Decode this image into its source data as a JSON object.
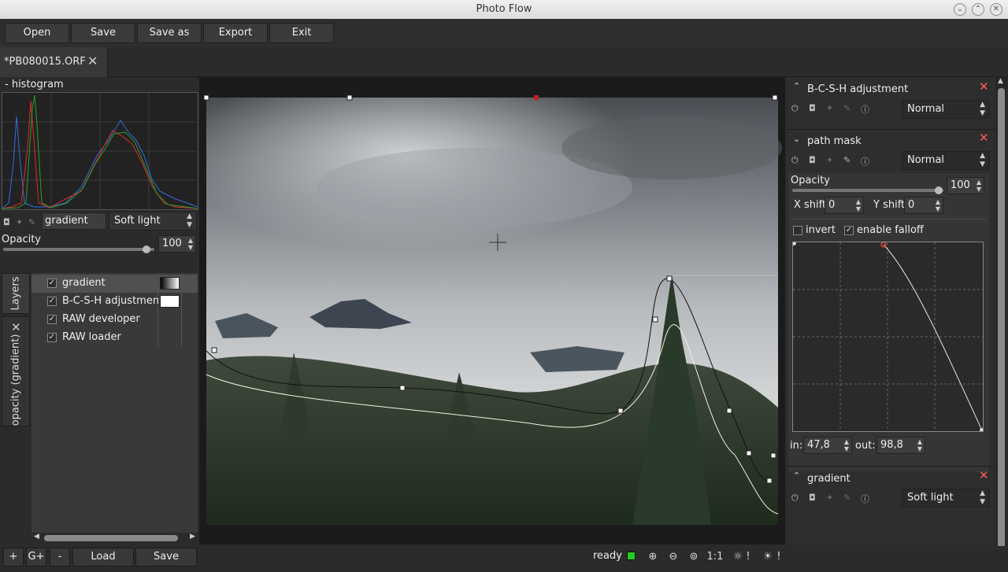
{
  "window": {
    "title": "Photo Flow"
  },
  "toolbar": {
    "open": "Open",
    "save": "Save",
    "save_as": "Save as",
    "export": "Export",
    "exit": "Exit"
  },
  "tabs": [
    {
      "label": "*PB080015.ORF"
    }
  ],
  "left": {
    "histogram_title": "- histogram",
    "layer_name_value": "gradient",
    "blend_mode": "Soft light",
    "opacity_label": "Opacity",
    "opacity_value": "100",
    "opacity_fraction": 0.95,
    "vtab_layers": "Layers",
    "vtab_opacity": "opacity (gradient)",
    "layers": [
      {
        "name": "gradient",
        "checked": true,
        "swatch": "gradient"
      },
      {
        "name": "B-C-S-H adjustment",
        "checked": true,
        "swatch": "#ffffff"
      },
      {
        "name": "RAW developer",
        "checked": true,
        "swatch": ""
      },
      {
        "name": "RAW loader",
        "checked": true,
        "swatch": ""
      }
    ]
  },
  "bottom": {
    "add": "+",
    "add_group": "G+",
    "remove": "-",
    "load": "Load",
    "save": "Save"
  },
  "status": {
    "text": "ready",
    "indicator_color": "#22cc22",
    "one_to_one": "1:1",
    "bang1": "!",
    "bang2": "!"
  },
  "right": {
    "bcsh": {
      "title": "B-C-S-H adjustment",
      "blend": "Normal"
    },
    "pathmask": {
      "title": "path mask",
      "blend": "Normal",
      "opacity_label": "Opacity",
      "opacity_value": "100",
      "opacity_fraction": 0.97,
      "xshift_label": "X shift",
      "xshift_value": "0",
      "yshift_label": "Y shift",
      "yshift_value": "0",
      "invert_label": "invert",
      "invert_checked": false,
      "falloff_label": "enable falloff",
      "falloff_checked": true,
      "in_label": "in:",
      "in_value": "47,8",
      "out_label": "out:",
      "out_value": "98,8"
    },
    "gradient": {
      "title": "gradient",
      "blend": "Soft light"
    }
  },
  "colors": {
    "close": "#ff5b5b",
    "curve_point_selected": "#e04040"
  }
}
